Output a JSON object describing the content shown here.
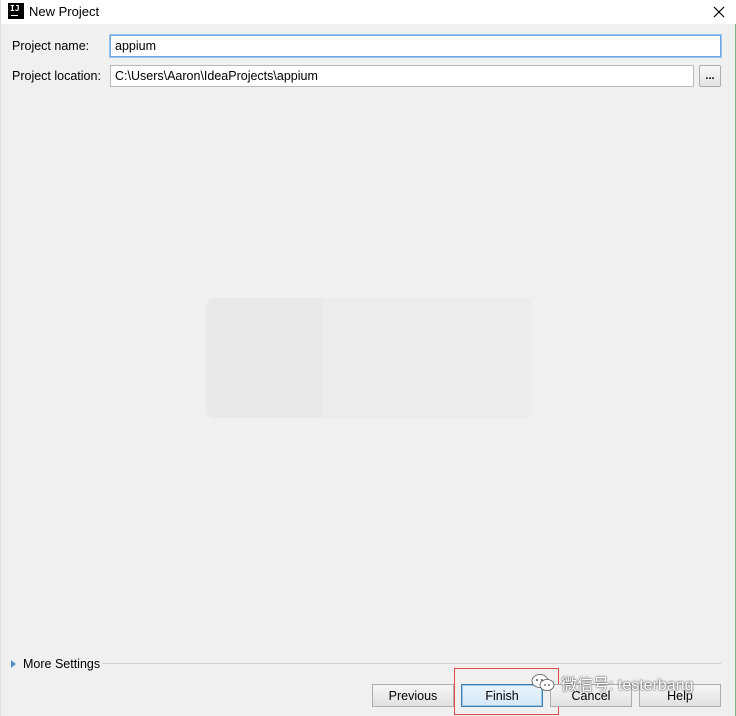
{
  "window": {
    "title": "New Project",
    "app_icon_text": "IJ"
  },
  "form": {
    "project_name_label": "Project name:",
    "project_name_value": "appium",
    "project_location_label": "Project location:",
    "project_location_value": "C:\\Users\\Aaron\\IdeaProjects\\appium",
    "browse_label": "..."
  },
  "more_settings": {
    "label": "More Settings"
  },
  "buttons": {
    "previous": "Previous",
    "finish": "Finish",
    "cancel": "Cancel",
    "help": "Help"
  },
  "watermark": {
    "text": "微信号: testerbang"
  },
  "colors": {
    "focus_border": "#6fa8dc",
    "highlight_box": "#e04848",
    "expand_arrow": "#5a8fc6"
  },
  "icons": {
    "close": "close-icon",
    "app": "intellij-app-icon",
    "expand": "triangle-right-icon",
    "wechat": "wechat-icon"
  }
}
